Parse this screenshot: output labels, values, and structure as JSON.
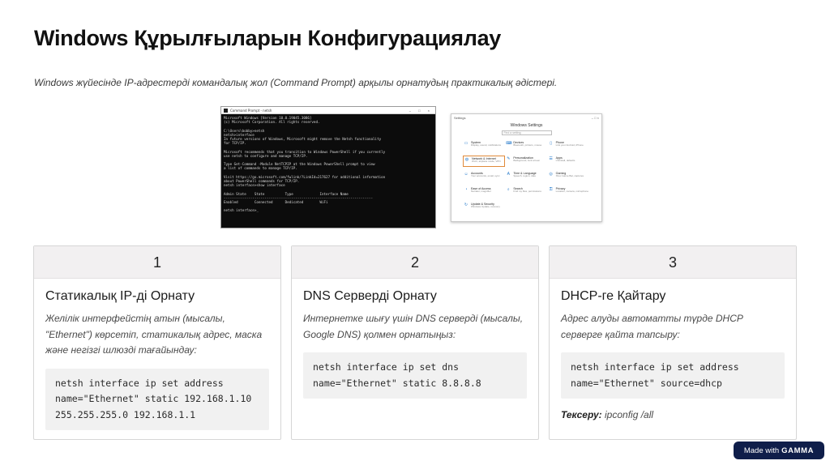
{
  "title": "Windows Құрылғыларын Конфигурациялау",
  "subtitle": "Windows жүйесінде IP-адрестерді командалық жол (Command Prompt) арқылы орнатудың практикалық әдістері.",
  "cmd_window": {
    "title": "Command Prompt - netsh",
    "controls": "– □ ×",
    "lines": [
      "Microsoft Windows [Version 10.0.19045.3086]",
      "(c) Microsoft Corporation. All rights reserved.",
      "",
      "C:\\Users\\bobby>netsh",
      "netsh>interface",
      "In future versions of Windows, Microsoft might remove the Netsh functionality",
      "for TCP/IP.",
      "",
      "Microsoft recommends that you transition to Windows PowerShell if you currently",
      "use netsh to configure and manage TCP/IP.",
      "",
      "Type Get-Command -Module NetTCPIP at the Windows PowerShell prompt to view",
      "a list of commands to manage TCP/IP.",
      "",
      "Visit https://go.microsoft.com/fwlink/?LinkId=217627 for additional information",
      "about PowerShell commands for TCP/IP.",
      "netsh interface>show interface",
      "",
      "Admin State    State          Type             Interface Name",
      "-------------------------------------------------------------------------",
      "Enabled        Connected      Dedicated        WiFi",
      "",
      "netsh interface>_"
    ]
  },
  "settings_window": {
    "title": "Settings",
    "controls": "– □ ×",
    "heading": "Windows Settings",
    "search_placeholder": "Find a setting",
    "items": [
      {
        "name": "System",
        "desc": "Display, sound, notifications",
        "icon": "▭"
      },
      {
        "name": "Devices",
        "desc": "Bluetooth, printers, mouse",
        "icon": "⌨"
      },
      {
        "name": "Phone",
        "desc": "Link your Android, iPhone",
        "icon": "▯"
      },
      {
        "name": "Network & Internet",
        "desc": "Wi-Fi, airplane mode, VPN",
        "icon": "◍"
      },
      {
        "name": "Personalization",
        "desc": "Background, lock screen",
        "icon": "✎"
      },
      {
        "name": "Apps",
        "desc": "Uninstall, defaults",
        "icon": "☰"
      },
      {
        "name": "Accounts",
        "desc": "Your accounts, email, sync",
        "icon": "☺"
      },
      {
        "name": "Time & Language",
        "desc": "Speech, region, date",
        "icon": "A"
      },
      {
        "name": "Gaming",
        "desc": "Xbox Game Bar, captures",
        "icon": "◎"
      },
      {
        "name": "Ease of Access",
        "desc": "Narrator, magnifier",
        "icon": "◔"
      },
      {
        "name": "Search",
        "desc": "Find my files, permissions",
        "icon": "⌕"
      },
      {
        "name": "Privacy",
        "desc": "Location, camera, microphone",
        "icon": "⚿"
      },
      {
        "name": "Update & Security",
        "desc": "Windows Update, recovery",
        "icon": "↻"
      }
    ],
    "highlighted_index": 3
  },
  "cards": [
    {
      "number": "1",
      "title": "Статикалық IP-ді Орнату",
      "desc": "Желілік интерфейстің атын (мысалы, \"Ethernet\") көрсетіп, статикалық адрес, маска және негізгі шлюзді тағайындау:",
      "code": "netsh interface ip set address\nname=\"Ethernet\" static 192.168.1.10\n255.255.255.0 192.168.1.1"
    },
    {
      "number": "2",
      "title": "DNS Серверді Орнату",
      "desc": "Интернетке шығу үшін DNS серверді (мысалы, Google DNS) қолмен орнатыңыз:",
      "code": "netsh interface ip set dns\nname=\"Ethernet\" static 8.8.8.8"
    },
    {
      "number": "3",
      "title": "DHCP-ге Қайтару",
      "desc": "Адрес алуды автоматты түрде DHCP серверге қайта тапсыру:",
      "code": "netsh interface ip set address\nname=\"Ethernet\" source=dhcp",
      "note_label": "Тексеру:",
      "note_value": " ipconfig /all"
    }
  ],
  "badge": {
    "made_with": "Made with",
    "brand": "GAMMA"
  },
  "colors": {
    "card_header_bg": "#f2f0f1",
    "code_bg": "#f1f1f1",
    "badge_bg": "#0f1e4a",
    "highlight": "#e08a3a"
  }
}
